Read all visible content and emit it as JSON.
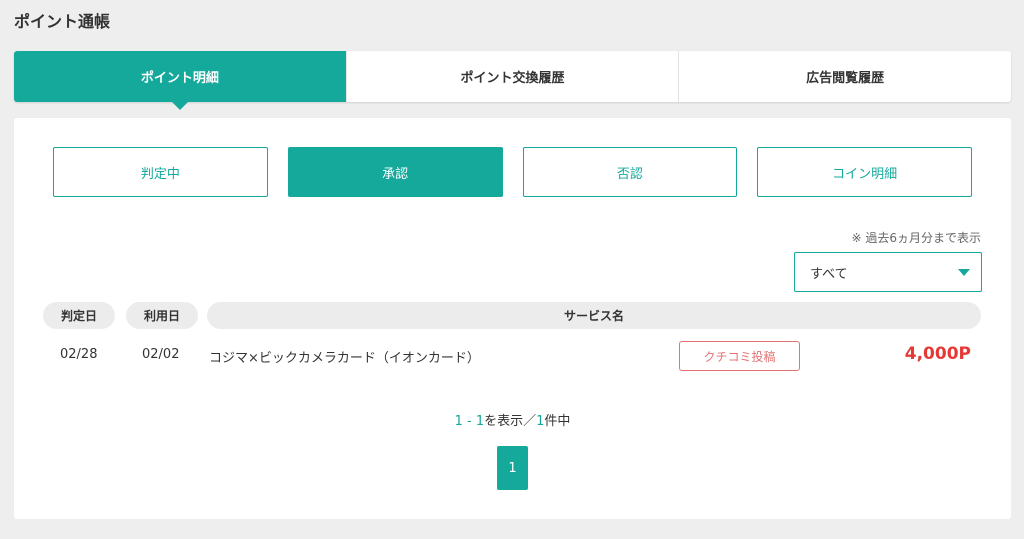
{
  "page": {
    "title": "ポイント通帳"
  },
  "tabs": [
    {
      "label": "ポイント明細",
      "active": true
    },
    {
      "label": "ポイント交換履歴",
      "active": false
    },
    {
      "label": "広告閲覧履歴",
      "active": false
    }
  ],
  "filters": [
    {
      "label": "判定中",
      "active": false
    },
    {
      "label": "承認",
      "active": true
    },
    {
      "label": "否認",
      "active": false
    },
    {
      "label": "コイン明細",
      "active": false
    }
  ],
  "note": "※ 過去6ヵ月分まで表示",
  "period_select": {
    "value": "すべて",
    "icon": "caret-down-icon"
  },
  "table": {
    "headers": {
      "judge_date": "判定日",
      "use_date": "利用日",
      "service": "サービス名"
    },
    "rows": [
      {
        "judge_date": "02/28",
        "use_date": "02/02",
        "service": "コジマ×ビックカメラカード（イオンカード）",
        "review_label": "クチコミ投稿",
        "points": "4,000P"
      }
    ]
  },
  "pager": {
    "range_start": "1",
    "range_sep": " - ",
    "range_end": "1",
    "mid_text": "を表示／",
    "total": "1",
    "suffix": "件中",
    "current_page": "1"
  },
  "colors": {
    "accent": "#14a99b",
    "points_red": "#e53935",
    "review_border": "#e57373",
    "background": "#eeeeee"
  }
}
